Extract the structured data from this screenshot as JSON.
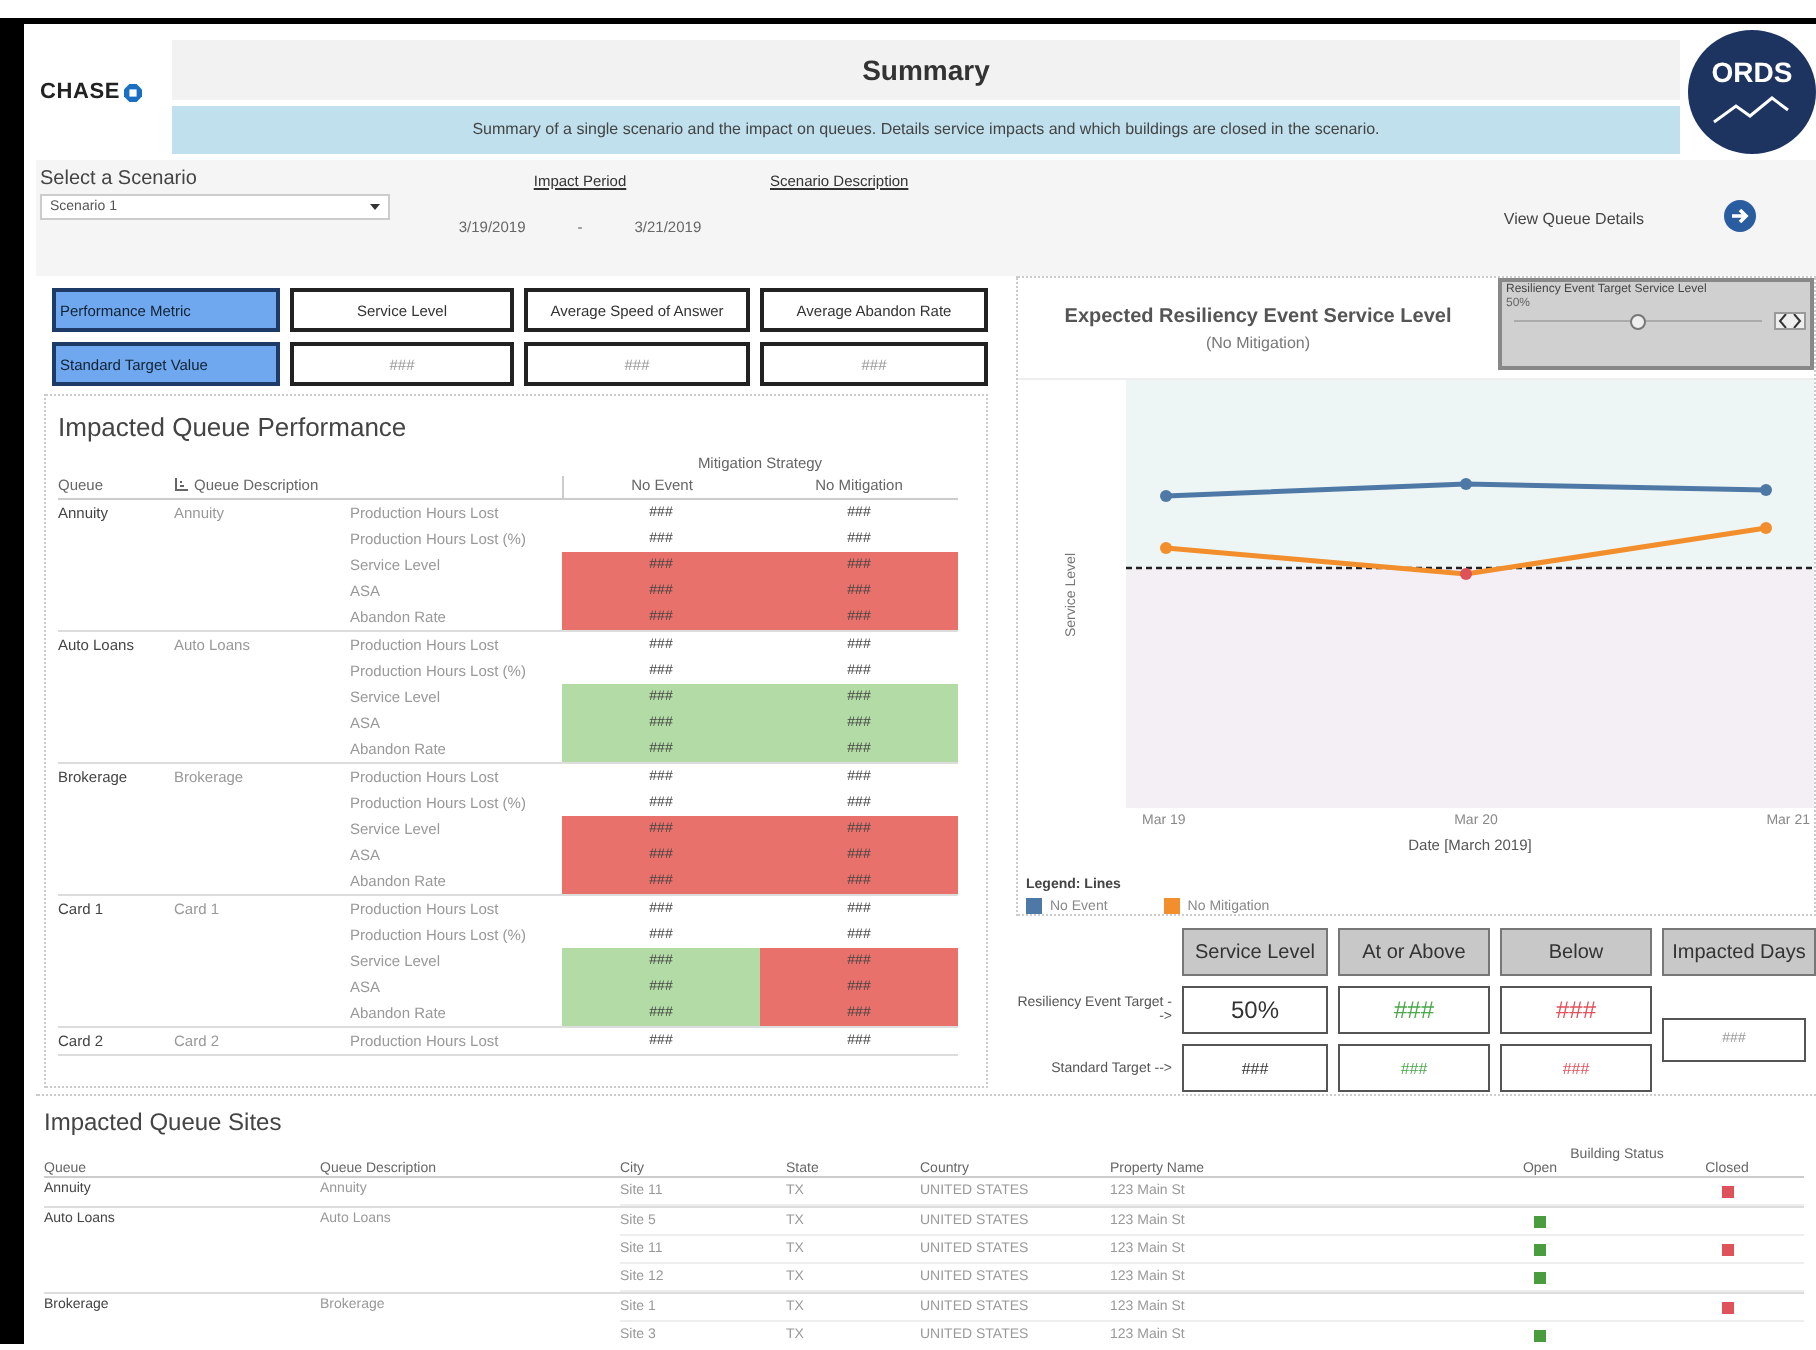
{
  "header": {
    "logo": "CHASE",
    "title": "Summary",
    "subtitle": "Summary of a single scenario and the impact on queues. Details service impacts and which buildings are closed in the scenario.",
    "badge": "ORDS"
  },
  "controls": {
    "scenario_label": "Select a Scenario",
    "scenario_value": "Scenario 1",
    "impact_period_label": "Impact Period",
    "start_date": "3/19/2019",
    "date_separator": "-",
    "end_date": "3/21/2019",
    "scenario_description_label": "Scenario Description",
    "view_details": "View Queue Details"
  },
  "metric_selector": {
    "label": "Performance Metric",
    "options": [
      "Service Level",
      "Average Speed of Answer",
      "Average Abandon Rate"
    ]
  },
  "target_values": {
    "label": "Standard Target Value",
    "values": [
      "###",
      "###",
      "###"
    ]
  },
  "queue_performance": {
    "title": "Impacted Queue Performance",
    "group_header": "Mitigation Strategy",
    "columns": [
      "Queue",
      "Queue Description",
      "No Event",
      "No Mitigation"
    ],
    "queues": [
      {
        "queue": "Annuity",
        "description": "Annuity",
        "metrics": [
          {
            "label": "Production Hours Lost",
            "cells": [
              {
                "value": "###",
                "kind": "none"
              },
              {
                "value": "###",
                "kind": "none"
              }
            ]
          },
          {
            "label": "Production Hours Lost (%)",
            "cells": [
              {
                "value": "###",
                "kind": "none"
              },
              {
                "value": "###",
                "kind": "none"
              }
            ]
          },
          {
            "label": "Service Level",
            "cells": [
              {
                "value": "###",
                "kind": "below"
              },
              {
                "value": "###",
                "kind": "below"
              }
            ]
          },
          {
            "label": "ASA",
            "cells": [
              {
                "value": "###",
                "kind": "below"
              },
              {
                "value": "###",
                "kind": "below"
              }
            ]
          },
          {
            "label": "Abandon Rate",
            "cells": [
              {
                "value": "###",
                "kind": "below"
              },
              {
                "value": "###",
                "kind": "below"
              }
            ]
          }
        ]
      },
      {
        "queue": "Auto Loans",
        "description": "Auto Loans",
        "metrics": [
          {
            "label": "Production Hours Lost",
            "cells": [
              {
                "value": "###",
                "kind": "none"
              },
              {
                "value": "###",
                "kind": "none"
              }
            ]
          },
          {
            "label": "Production Hours Lost (%)",
            "cells": [
              {
                "value": "###",
                "kind": "none"
              },
              {
                "value": "###",
                "kind": "none"
              }
            ]
          },
          {
            "label": "Service Level",
            "cells": [
              {
                "value": "###",
                "kind": "above"
              },
              {
                "value": "###",
                "kind": "above"
              }
            ]
          },
          {
            "label": "ASA",
            "cells": [
              {
                "value": "###",
                "kind": "above"
              },
              {
                "value": "###",
                "kind": "above"
              }
            ]
          },
          {
            "label": "Abandon Rate",
            "cells": [
              {
                "value": "###",
                "kind": "above"
              },
              {
                "value": "###",
                "kind": "above"
              }
            ]
          }
        ]
      },
      {
        "queue": "Brokerage",
        "description": "Brokerage",
        "metrics": [
          {
            "label": "Production Hours Lost",
            "cells": [
              {
                "value": "###",
                "kind": "none"
              },
              {
                "value": "###",
                "kind": "none"
              }
            ]
          },
          {
            "label": "Production Hours Lost (%)",
            "cells": [
              {
                "value": "###",
                "kind": "none"
              },
              {
                "value": "###",
                "kind": "none"
              }
            ]
          },
          {
            "label": "Service Level",
            "cells": [
              {
                "value": "###",
                "kind": "below"
              },
              {
                "value": "###",
                "kind": "below"
              }
            ]
          },
          {
            "label": "ASA",
            "cells": [
              {
                "value": "###",
                "kind": "below"
              },
              {
                "value": "###",
                "kind": "below"
              }
            ]
          },
          {
            "label": "Abandon Rate",
            "cells": [
              {
                "value": "###",
                "kind": "below"
              },
              {
                "value": "###",
                "kind": "below"
              }
            ]
          }
        ]
      },
      {
        "queue": "Card 1",
        "description": "Card 1",
        "metrics": [
          {
            "label": "Production Hours Lost",
            "cells": [
              {
                "value": "###",
                "kind": "none"
              },
              {
                "value": "###",
                "kind": "none"
              }
            ]
          },
          {
            "label": "Production Hours Lost (%)",
            "cells": [
              {
                "value": "###",
                "kind": "none"
              },
              {
                "value": "###",
                "kind": "none"
              }
            ]
          },
          {
            "label": "Service Level",
            "cells": [
              {
                "value": "###",
                "kind": "above"
              },
              {
                "value": "###",
                "kind": "below"
              }
            ]
          },
          {
            "label": "ASA",
            "cells": [
              {
                "value": "###",
                "kind": "above"
              },
              {
                "value": "###",
                "kind": "below"
              }
            ]
          },
          {
            "label": "Abandon Rate",
            "cells": [
              {
                "value": "###",
                "kind": "above"
              },
              {
                "value": "###",
                "kind": "below"
              }
            ]
          }
        ]
      },
      {
        "queue": "Card 2",
        "description": "Card 2",
        "metrics": [
          {
            "label": "Production Hours Lost",
            "cells": [
              {
                "value": "###",
                "kind": "none"
              },
              {
                "value": "###",
                "kind": "none"
              }
            ]
          }
        ]
      }
    ]
  },
  "service_chart": {
    "title": "Expected Resiliency Event Service Level",
    "subtitle": "(No Mitigation)",
    "ylabel": "Service Level",
    "xlabel": "Date [March 2019]",
    "x_labels": [
      "Mar 19",
      "Mar 20",
      "Mar 21"
    ],
    "legend_title": "Legend: Lines",
    "legend": [
      {
        "label": "No Event",
        "color": "#4e79a7"
      },
      {
        "label": "No Mitigation",
        "color": "#f28e2b"
      }
    ]
  },
  "target_slider": {
    "label": "Resiliency Event Target Service Level",
    "value": "50%",
    "level": 0.5
  },
  "summary_grid": {
    "headers": [
      "Service Level",
      "At or Above",
      "Below",
      "Impacted Days"
    ],
    "rows": [
      {
        "label": "Resiliency Event Target -->",
        "cells": [
          {
            "value": "50%",
            "kind": "plain"
          },
          {
            "value": "###",
            "kind": "above"
          },
          {
            "value": "###",
            "kind": "below"
          }
        ]
      },
      {
        "label": "Standard Target -->",
        "cells": [
          {
            "value": "###",
            "kind": "plain"
          },
          {
            "value": "###",
            "kind": "above"
          },
          {
            "value": "###",
            "kind": "below"
          }
        ]
      }
    ],
    "impacted_days": "###"
  },
  "queue_sites": {
    "title": "Impacted Queue Sites",
    "columns": [
      "Queue",
      "Queue Description",
      "City",
      "State",
      "Country",
      "Property Name"
    ],
    "status_header": "Building Status",
    "status_columns": [
      "Open",
      "Closed"
    ],
    "groups": [
      {
        "queue": "Annuity",
        "description": "Annuity",
        "sites": [
          {
            "city": "Site 11",
            "state": "TX",
            "country": "UNITED STATES",
            "property": "123 Main St",
            "open": false,
            "closed": true
          }
        ]
      },
      {
        "queue": "Auto Loans",
        "description": "Auto Loans",
        "sites": [
          {
            "city": "Site 5",
            "state": "TX",
            "country": "UNITED STATES",
            "property": "123 Main St",
            "open": true,
            "closed": false
          },
          {
            "city": "Site 11",
            "state": "TX",
            "country": "UNITED STATES",
            "property": "123 Main St",
            "open": true,
            "closed": true
          },
          {
            "city": "Site 12",
            "state": "TX",
            "country": "UNITED STATES",
            "property": "123 Main St",
            "open": true,
            "closed": false
          }
        ]
      },
      {
        "queue": "Brokerage",
        "description": "Brokerage",
        "sites": [
          {
            "city": "Site 1",
            "state": "TX",
            "country": "UNITED STATES",
            "property": "123 Main St",
            "open": false,
            "closed": true
          },
          {
            "city": "Site 3",
            "state": "TX",
            "country": "UNITED STATES",
            "property": "123 Main St",
            "open": true,
            "closed": false
          }
        ]
      }
    ]
  }
}
